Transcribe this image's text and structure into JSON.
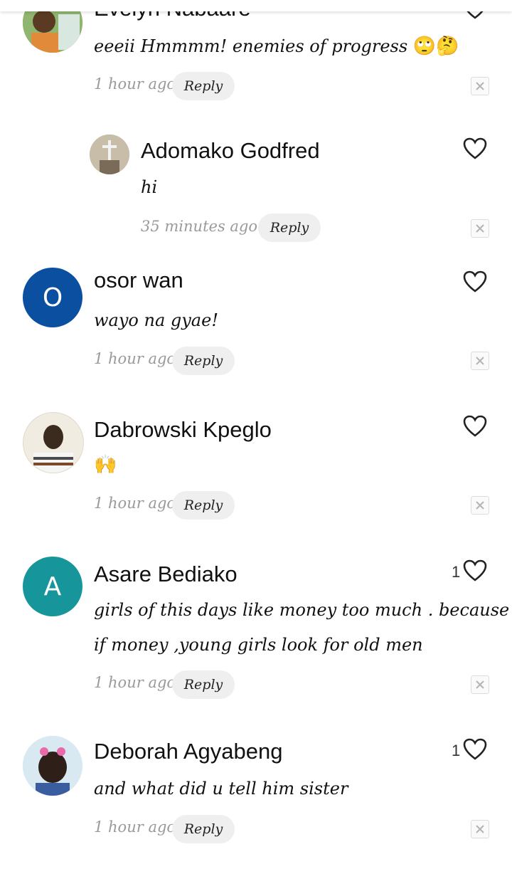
{
  "comments": [
    {
      "author": "Evelyn Nabaare",
      "text": "eeeii Hmmmm! enemies of progress",
      "emojis": "🙄🤔",
      "time": "1 hour ago",
      "reply": "Reply",
      "avatar_color": "#6e9b5a"
    },
    {
      "author": "Adomako Godfred",
      "text": "hi",
      "time": "35 minutes ago",
      "reply": "Reply",
      "avatar_color": "#a59c88"
    },
    {
      "author": "osor wan",
      "text": "wayo na gyae!",
      "time": "1 hour ago",
      "reply": "Reply",
      "avatar_letter": "O",
      "avatar_color": "#0a4fa0"
    },
    {
      "author": "Dabrowski Kpeglo",
      "emojis": "🙌",
      "time": "1 hour ago",
      "reply": "Reply",
      "avatar_color": "#e9e2d6"
    },
    {
      "author": "Asare Bediako",
      "text_line1": "girls of this days like money too much . because",
      "text_line2": "if money ,young girls look for old men",
      "time": "1 hour ago",
      "reply": "Reply",
      "avatar_letter": "A",
      "avatar_color": "#16969a",
      "like_count": "1"
    },
    {
      "author": "Deborah Agyabeng",
      "text": "and what did u tell him sister",
      "time": "1 hour ago",
      "reply": "Reply",
      "avatar_color": "#cfe3ef",
      "like_count": "1"
    }
  ]
}
